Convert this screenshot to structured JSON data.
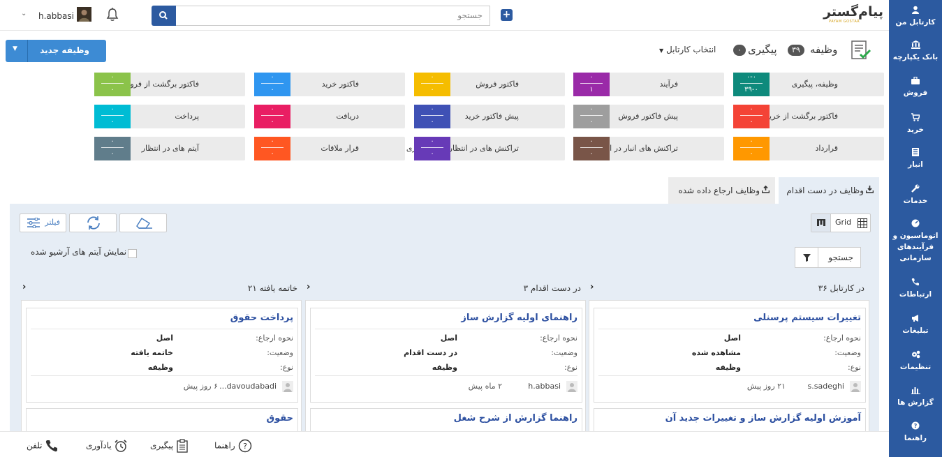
{
  "sidebar": {
    "items": [
      {
        "icon": "user-icon",
        "label": "کارتابل من"
      },
      {
        "icon": "bank-icon",
        "label": "بانک یکپارچه"
      },
      {
        "icon": "briefcase-icon",
        "label": "فروش"
      },
      {
        "icon": "cart-icon",
        "label": "خرید"
      },
      {
        "icon": "warehouse-icon",
        "label": "انبار"
      },
      {
        "icon": "wrench-icon",
        "label": "خدمات"
      },
      {
        "icon": "gauge-icon",
        "label": "اتوماسیون و فرآیندهای سازمانی"
      },
      {
        "icon": "phone-icon",
        "label": "ارتباطات"
      },
      {
        "icon": "megaphone-icon",
        "label": "تبلیغات"
      },
      {
        "icon": "gears-icon",
        "label": "تنظیمات"
      },
      {
        "icon": "bar-chart-icon",
        "label": "گزارش ها"
      },
      {
        "icon": "help-icon",
        "label": "راهنما"
      }
    ]
  },
  "topbar": {
    "logo_text": "پیام‌گستر",
    "logo_sub": "PAYAM GOSTAR",
    "search_placeholder": "جستجو",
    "username": "h.abbasi"
  },
  "header": {
    "task_label": "وظیفه",
    "task_count": "۳۹",
    "followup_label": "پیگیری",
    "followup_count": "۰",
    "kartabl_select": "انتخاب کارتابل",
    "new_task_button": "وظیفه جدید"
  },
  "tiles": [
    {
      "label": "وظیفه، پیگیری",
      "top": "۰-۰",
      "bottom": "۳۹-۰",
      "color": "#0e8a7c"
    },
    {
      "label": "فرآیند",
      "top": "۰",
      "bottom": "۱",
      "color": "#9a2aa8"
    },
    {
      "label": "فاکتور فروش",
      "top": "۰",
      "bottom": "۰",
      "color": "#f5bd00"
    },
    {
      "label": "فاکتور خرید",
      "top": "۰",
      "bottom": "۰",
      "color": "#2f96f0"
    },
    {
      "label": "فاکتور برگشت از فروش",
      "top": "۰",
      "bottom": "۰",
      "color": "#8bc34a"
    },
    {
      "label": "فاکتور برگشت از خرید",
      "top": "۰",
      "bottom": "۰",
      "color": "#f44336"
    },
    {
      "label": "پیش فاکتور فروش",
      "top": "۰",
      "bottom": "۰",
      "color": "#9e9e9e"
    },
    {
      "label": "پیش فاکتور خرید",
      "top": "۰",
      "bottom": "۰",
      "color": "#3f51b5"
    },
    {
      "label": "دریافت",
      "top": "۰",
      "bottom": "۰",
      "color": "#e91e63"
    },
    {
      "label": "پرداخت",
      "top": "۰",
      "bottom": "۰",
      "color": "#00bcd4"
    },
    {
      "label": "قرارداد",
      "top": "۰",
      "bottom": "۰",
      "color": "#ff9800"
    },
    {
      "label": "تراکنش های انبار در انتظار",
      "top": "۰",
      "bottom": "۰",
      "color": "#795548"
    },
    {
      "label": "تراکنش های در انتظار قیمت گذاری",
      "top": "۰",
      "bottom": "۰",
      "color": "#673ab7"
    },
    {
      "label": "قرار ملاقات",
      "top": "۰",
      "bottom": "۰",
      "color": "#ff5722"
    },
    {
      "label": "آیتم های در انتظار",
      "top": "۰",
      "bottom": "۰",
      "color": "#607d8b"
    }
  ],
  "tabs": {
    "active": "وظایف در دست اقدام",
    "inactive": "وظایف ارجاع داده شده"
  },
  "toolbar": {
    "grid_label": "Grid",
    "filter_label": "فیلتر",
    "search_label": "جستجو",
    "archive_label": "نمایش آیتم های آرشیو شده"
  },
  "columns": [
    {
      "header": "در کارتابل ۳۶",
      "cards": [
        {
          "title": "تغییرات سیستم پرسنلی",
          "k1": "نحوه ارجاع:",
          "v1": "اصل",
          "k2": "وضعیت:",
          "v2": "مشاهده شده",
          "k3": "نوع:",
          "v3": "وظیفه",
          "user": "s.sadeghi",
          "time": "۲۱ روز پیش"
        },
        {
          "title": "آموزش اولیه گزارش ساز و تغییرات جدید آن"
        }
      ]
    },
    {
      "header": "در دست اقدام ۳",
      "cards": [
        {
          "title": "راهنمای اولیه گزارش ساز",
          "k1": "نحوه ارجاع:",
          "v1": "اصل",
          "k2": "وضعیت:",
          "v2": "در دست اقدام",
          "k3": "نوع:",
          "v3": "وظیفه",
          "user": "h.abbasi",
          "time": "۲ ماه پیش"
        },
        {
          "title": "راهنما گزارش از شرح شغل"
        }
      ]
    },
    {
      "header": "خاتمه یافته ۲۱",
      "cards": [
        {
          "title": "پرداخت حقوق",
          "k1": "نحوه ارجاع:",
          "v1": "اصل",
          "k2": "وضعیت:",
          "v2": "خاتمه یافته",
          "k3": "نوع:",
          "v3": "وظیفه",
          "user": "davoudabadi...",
          "time": "۶ روز پیش"
        },
        {
          "title": "حقوق"
        }
      ]
    }
  ],
  "bottombar": {
    "help": "راهنما",
    "followup": "پیگیری",
    "reminder": "یادآوری",
    "phone": "تلفن"
  }
}
